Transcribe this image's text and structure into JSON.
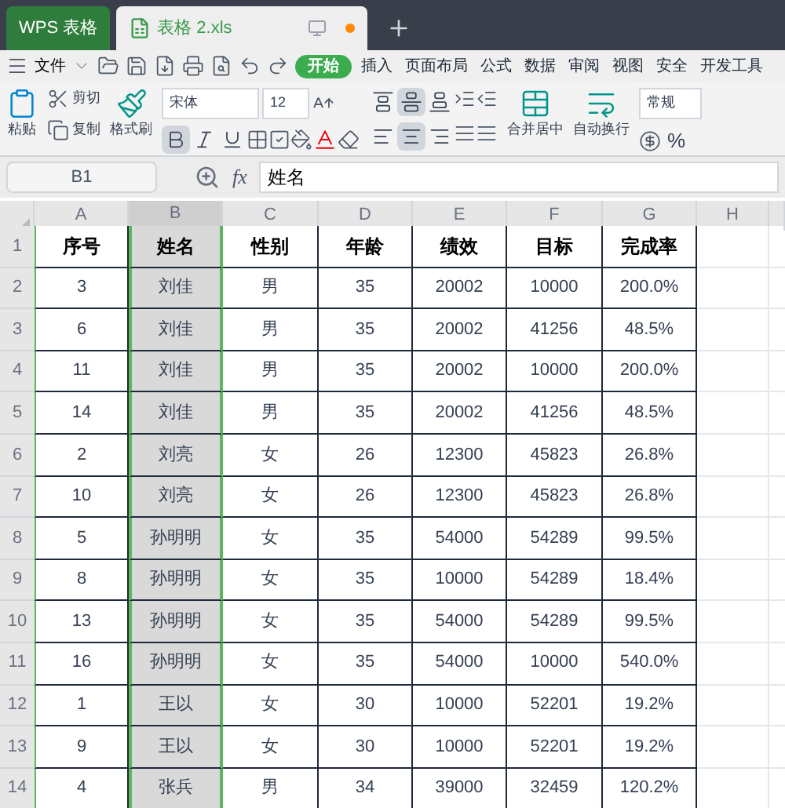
{
  "tabs": [
    {
      "label": "WPS 表格",
      "selected": false
    },
    {
      "label": "表格 2.xls",
      "selected": true
    }
  ],
  "menu": {
    "file": "文件",
    "items": [
      {
        "label": "开始",
        "selected": true
      },
      {
        "label": "插入",
        "selected": false
      },
      {
        "label": "页面布局",
        "selected": false
      },
      {
        "label": "公式",
        "selected": false
      },
      {
        "label": "数据",
        "selected": false
      },
      {
        "label": "审阅",
        "selected": false
      },
      {
        "label": "视图",
        "selected": false
      },
      {
        "label": "安全",
        "selected": false
      },
      {
        "label": "开发工具",
        "selected": false
      }
    ]
  },
  "ribbon": {
    "paste": "粘贴",
    "cut": "剪切",
    "copy": "复制",
    "format_painter": "格式刷",
    "font_name": "宋体",
    "font_size": "12",
    "bold": true,
    "italic": false,
    "underline": false,
    "vertical_alignment": [
      {
        "kind": "top",
        "selected": false
      },
      {
        "kind": "middle",
        "selected": true
      },
      {
        "kind": "bottom",
        "selected": false
      }
    ],
    "horizontal_alignment": [
      {
        "kind": "left",
        "selected": false
      },
      {
        "kind": "center",
        "selected": true
      },
      {
        "kind": "right",
        "selected": false
      }
    ],
    "merge": "合并居中",
    "wrap": "自动换行",
    "number_format": "常规",
    "percent": "%"
  },
  "formula_bar": {
    "cell": "B1",
    "fx": "fx",
    "content": "姓名"
  },
  "sheet": {
    "columns": [
      {
        "label": "A",
        "selected": false
      },
      {
        "label": "B",
        "selected": true
      },
      {
        "label": "C",
        "selected": false
      },
      {
        "label": "D",
        "selected": false
      },
      {
        "label": "E",
        "selected": false
      },
      {
        "label": "F",
        "selected": false
      },
      {
        "label": "G",
        "selected": false
      },
      {
        "label": "H",
        "selected": false
      }
    ],
    "rows": [
      {
        "header": "1",
        "cells": [
          "序号",
          "姓名",
          "性别",
          "年龄",
          "绩效",
          "目标",
          "完成率"
        ]
      },
      {
        "header": "2",
        "cells": [
          "3",
          "刘佳",
          "男",
          "35",
          "20002",
          "10000",
          "200.0%"
        ]
      },
      {
        "header": "3",
        "cells": [
          "6",
          "刘佳",
          "男",
          "35",
          "20002",
          "41256",
          "48.5%"
        ]
      },
      {
        "header": "4",
        "cells": [
          "11",
          "刘佳",
          "男",
          "35",
          "20002",
          "10000",
          "200.0%"
        ]
      },
      {
        "header": "5",
        "cells": [
          "14",
          "刘佳",
          "男",
          "35",
          "20002",
          "41256",
          "48.5%"
        ]
      },
      {
        "header": "6",
        "cells": [
          "2",
          "刘亮",
          "女",
          "26",
          "12300",
          "45823",
          "26.8%"
        ]
      },
      {
        "header": "7",
        "cells": [
          "10",
          "刘亮",
          "女",
          "26",
          "12300",
          "45823",
          "26.8%"
        ]
      },
      {
        "header": "8",
        "cells": [
          "5",
          "孙明明",
          "女",
          "35",
          "54000",
          "54289",
          "99.5%"
        ]
      },
      {
        "header": "9",
        "cells": [
          "8",
          "孙明明",
          "女",
          "35",
          "10000",
          "54289",
          "18.4%"
        ]
      },
      {
        "header": "10",
        "cells": [
          "13",
          "孙明明",
          "女",
          "35",
          "54000",
          "54289",
          "99.5%"
        ]
      },
      {
        "header": "11",
        "cells": [
          "16",
          "孙明明",
          "女",
          "35",
          "54000",
          "10000",
          "540.0%"
        ]
      },
      {
        "header": "12",
        "cells": [
          "1",
          "王以",
          "女",
          "30",
          "10000",
          "52201",
          "19.2%"
        ]
      },
      {
        "header": "13",
        "cells": [
          "9",
          "王以",
          "女",
          "30",
          "10000",
          "52201",
          "19.2%"
        ]
      },
      {
        "header": "14",
        "cells": [
          "4",
          "张兵",
          "男",
          "34",
          "39000",
          "32459",
          "120.2%"
        ]
      }
    ]
  }
}
